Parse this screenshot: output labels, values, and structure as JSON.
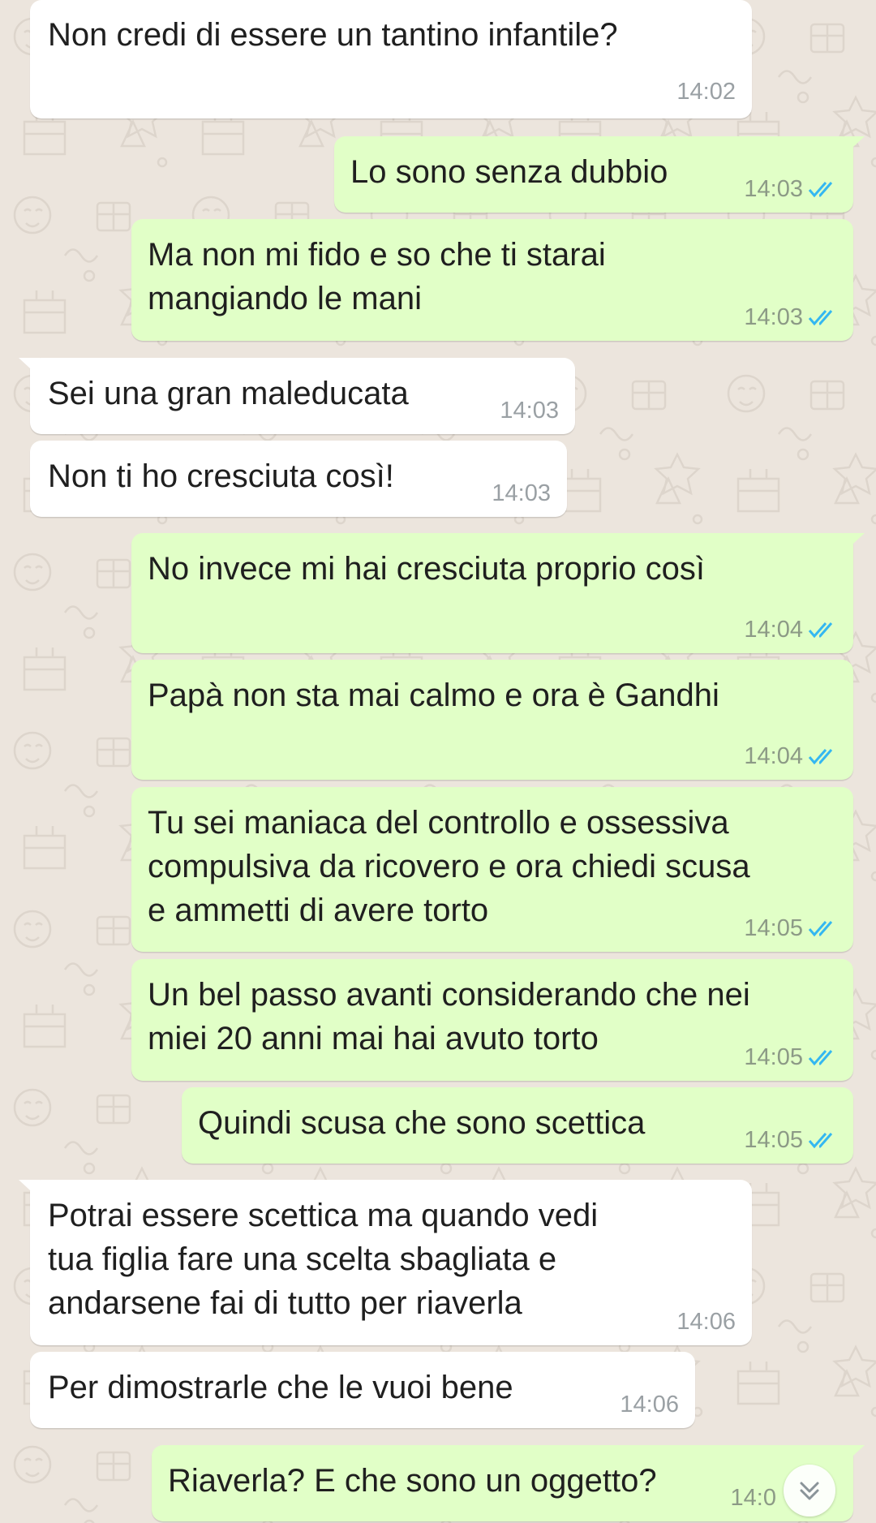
{
  "colors": {
    "incoming_bubble": "#FFFFFF",
    "outgoing_bubble": "#E1FFC7",
    "read_ticks": "#34B7F1",
    "chat_background": "#ECE5DD"
  },
  "messages": [
    {
      "dir": "in",
      "lines": [
        "Non credi di essere un tantino infantile?"
      ],
      "time": "14:02"
    },
    {
      "dir": "out",
      "lines": [
        "Lo sono senza dubbio"
      ],
      "time": "14:03",
      "status": "read"
    },
    {
      "dir": "out",
      "lines": [
        "Ma non mi fido e so che ti starai",
        "mangiando le mani"
      ],
      "time": "14:03",
      "status": "read"
    },
    {
      "dir": "in",
      "lines": [
        "Sei una gran maleducata"
      ],
      "time": "14:03"
    },
    {
      "dir": "in",
      "lines": [
        "Non ti ho cresciuta così!"
      ],
      "time": "14:03"
    },
    {
      "dir": "out",
      "lines": [
        "No invece mi hai cresciuta proprio così"
      ],
      "time": "14:04",
      "status": "read"
    },
    {
      "dir": "out",
      "lines": [
        "Papà non sta mai calmo e ora è Gandhi"
      ],
      "time": "14:04",
      "status": "read"
    },
    {
      "dir": "out",
      "lines": [
        "Tu sei maniaca del controllo e ossessiva",
        "compulsiva da ricovero e ora chiedi scusa",
        "e ammetti di avere torto"
      ],
      "time": "14:05",
      "status": "read"
    },
    {
      "dir": "out",
      "lines": [
        "Un bel passo avanti considerando che nei",
        "miei 20 anni mai hai avuto torto"
      ],
      "time": "14:05",
      "status": "read"
    },
    {
      "dir": "out",
      "lines": [
        "Quindi scusa che sono scettica"
      ],
      "time": "14:05",
      "status": "read"
    },
    {
      "dir": "in",
      "lines": [
        "Potrai essere scettica ma quando vedi",
        "tua figlia fare una scelta sbagliata e",
        "andarsene fai di tutto per riaverla"
      ],
      "time": "14:06"
    },
    {
      "dir": "in",
      "lines": [
        "Per dimostrarle che le vuoi bene"
      ],
      "time": "14:06"
    },
    {
      "dir": "out",
      "lines": [
        "Riaverla? E che sono un oggetto?"
      ],
      "time": "14:0",
      "status": "read"
    }
  ],
  "scroll_button": {
    "icon": "double-chevron-down-icon"
  }
}
